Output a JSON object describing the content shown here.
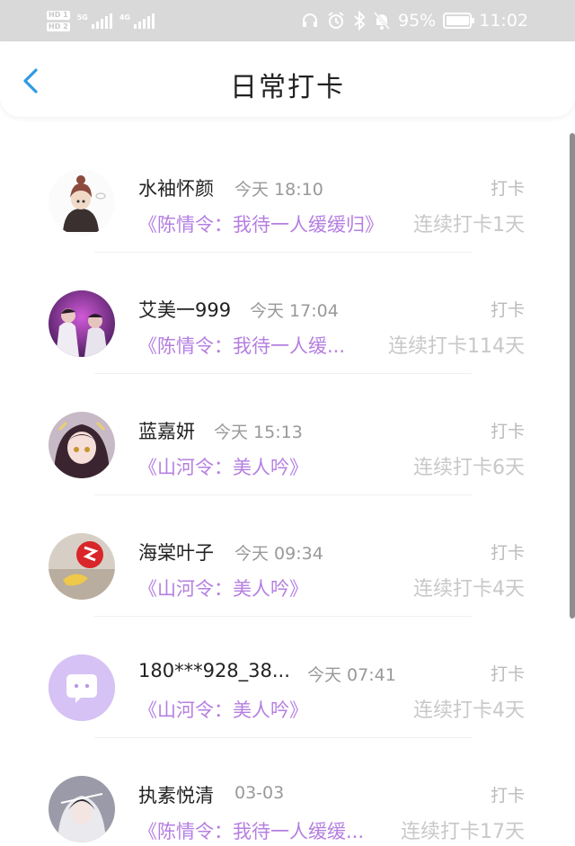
{
  "status_bar": {
    "battery": "95%",
    "time": "11:02",
    "net_1": "5G",
    "net_2": "4G",
    "hd_1": "HD 1",
    "hd_2": "HD 2"
  },
  "header": {
    "title": "日常打卡"
  },
  "items": [
    {
      "name": "水袖怀颜",
      "time": "今天 18:10",
      "action": "打卡",
      "book": "《陈情令：我待一人缓缓归》",
      "streak": "连续打卡1天"
    },
    {
      "name": "艾美一999",
      "time": "今天 17:04",
      "action": "打卡",
      "book": "《陈情令：我待一人缓...",
      "streak": "连续打卡114天"
    },
    {
      "name": "蓝嘉妍",
      "time": "今天 15:13",
      "action": "打卡",
      "book": "《山河令：美人吟》",
      "streak": "连续打卡6天"
    },
    {
      "name": "海棠叶子",
      "time": "今天 09:34",
      "action": "打卡",
      "book": "《山河令：美人吟》",
      "streak": "连续打卡4天"
    },
    {
      "name": "180***928_38...",
      "time": "今天 07:41",
      "action": "打卡",
      "book": "《山河令：美人吟》",
      "streak": "连续打卡4天"
    },
    {
      "name": "执素悦清",
      "time": "03-03",
      "action": "打卡",
      "book": "《陈情令：我待一人缓缓...",
      "streak": "连续打卡17天"
    }
  ],
  "colors": {
    "accent_back": "#2f9be6",
    "book_title": "#b57fe0",
    "status_bar_bg": "#d9d9d9"
  }
}
